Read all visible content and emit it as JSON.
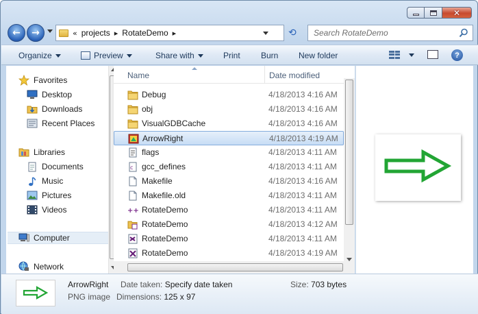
{
  "window": {
    "caption_buttons": [
      "minimize",
      "maximize",
      "close"
    ]
  },
  "navigation": {
    "breadcrumb": [
      "«",
      "projects",
      "RotateDemo"
    ],
    "search_placeholder": "Search RotateDemo"
  },
  "toolbar": {
    "organize": "Organize",
    "preview": "Preview",
    "share_with": "Share with",
    "print": "Print",
    "burn": "Burn",
    "new_folder": "New folder"
  },
  "sidebar": {
    "favorites_label": "Favorites",
    "favorites": [
      "Desktop",
      "Downloads",
      "Recent Places"
    ],
    "libraries_label": "Libraries",
    "libraries": [
      "Documents",
      "Music",
      "Pictures",
      "Videos"
    ],
    "computer": "Computer",
    "network": "Network"
  },
  "file_list": {
    "columns": [
      "Name",
      "Date modified"
    ],
    "rows": [
      {
        "name": "Debug",
        "date": "4/18/2013 4:16 AM",
        "icon": "folder-icon"
      },
      {
        "name": "obj",
        "date": "4/18/2013 4:16 AM",
        "icon": "folder-icon"
      },
      {
        "name": "VisualGDBCache",
        "date": "4/18/2013 4:16 AM",
        "icon": "folder-icon"
      },
      {
        "name": "ArrowRight",
        "date": "4/18/2013 4:19 AM",
        "icon": "image-file-icon",
        "selected": true
      },
      {
        "name": "flags",
        "date": "4/18/2013 4:11 AM",
        "icon": "document-icon"
      },
      {
        "name": "gcc_defines",
        "date": "4/18/2013 4:11 AM",
        "icon": "code-file-icon"
      },
      {
        "name": "Makefile",
        "date": "4/18/2013 4:16 AM",
        "icon": "blank-file-icon"
      },
      {
        "name": "Makefile.old",
        "date": "4/18/2013 4:11 AM",
        "icon": "blank-file-icon"
      },
      {
        "name": "RotateDemo",
        "date": "4/18/2013 4:11 AM",
        "icon": "cpp-source-icon"
      },
      {
        "name": "RotateDemo",
        "date": "4/18/2013 4:12 AM",
        "icon": "project-file-icon"
      },
      {
        "name": "RotateDemo",
        "date": "4/18/2013 4:11 AM",
        "icon": "vs-solution-icon"
      },
      {
        "name": "RotateDemo",
        "date": "4/18/2013 4:19 AM",
        "icon": "vs-filters-icon"
      }
    ]
  },
  "details": {
    "name": "ArrowRight",
    "type": "PNG image",
    "date_taken_label": "Date taken:",
    "date_taken_value": "Specify date taken",
    "dimensions_label": "Dimensions:",
    "dimensions_value": "125 x 97",
    "size_label": "Size:",
    "size_value": "703 bytes"
  },
  "colors": {
    "arrow_green": "#22a534",
    "selection_border": "#84acdd",
    "link_text": "#1e395b"
  }
}
